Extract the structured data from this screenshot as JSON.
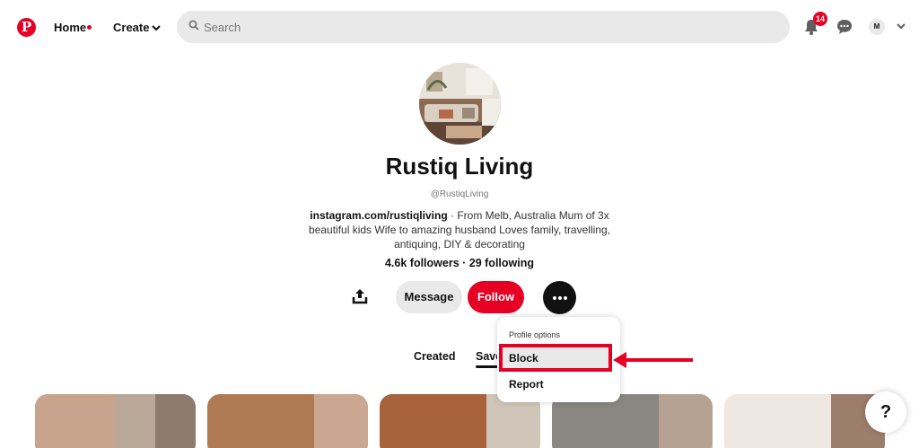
{
  "header": {
    "logo_letter": "P",
    "home_label": "Home",
    "create_label": "Create",
    "search_placeholder": "Search",
    "notification_count": "14",
    "account_initial": "M"
  },
  "profile": {
    "name": "Rustiq Living",
    "handle": "@RustiqLiving",
    "bio_link": "instagram.com/rustiqliving",
    "bio_text": " · From Melb, Australia Mum of 3x beautiful kids Wife to amazing husband Loves family, travelling, antiquing, DIY & decorating",
    "stats": "4.6k followers · 29 following",
    "message_label": "Message",
    "follow_label": "Follow"
  },
  "dropdown": {
    "title": "Profile options",
    "items": [
      {
        "label": "Block"
      },
      {
        "label": "Report"
      }
    ]
  },
  "tabs": {
    "created": "Created",
    "saved": "Saved"
  },
  "help_label": "?",
  "colors": {
    "brand": "#e60023",
    "annotation": "#e60023",
    "search_bg": "#e9e9e9"
  },
  "icons": [
    "pinterest-logo",
    "chevron-down-icon",
    "search-icon",
    "bell-icon",
    "chat-icon",
    "share-icon",
    "more-icon",
    "arrow-icon",
    "help-icon"
  ]
}
